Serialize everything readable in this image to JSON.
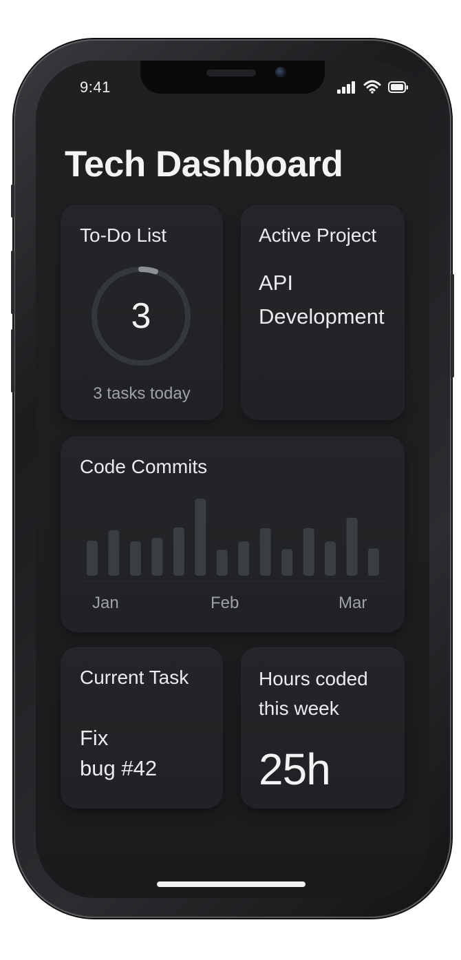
{
  "status_bar": {
    "time": "9:41",
    "icons": [
      "signal-icon",
      "wifi-icon",
      "battery-icon"
    ]
  },
  "title": "Tech Dashboard",
  "todo_card": {
    "label": "To-Do List",
    "count": "3",
    "subtitle": "3 tasks today",
    "progress_fraction": 0.05
  },
  "project_card": {
    "label": "Active Project",
    "name_line1": "API",
    "name_line2": "Development"
  },
  "commits_card": {
    "label": "Code Commits"
  },
  "task_card": {
    "label": "Current Task",
    "task_line1": "Fix",
    "task_line2": "bug #42"
  },
  "hours_card": {
    "label_line1": "Hours coded",
    "label_line2": "this week",
    "value": "25h"
  },
  "chart_data": {
    "type": "bar",
    "title": "Code Commits",
    "x_tick_labels": [
      "Jan",
      "Feb",
      "Mar"
    ],
    "values": [
      5,
      6.5,
      4.9,
      5.4,
      6.9,
      11,
      3.7,
      4.9,
      6.8,
      3.8,
      6.8,
      4.9,
      8.3,
      3.9
    ],
    "ylim": [
      0,
      12
    ],
    "bar_color": "#3a3d42",
    "grid": false,
    "legend": "none"
  },
  "colors": {
    "background": "#1c1e20",
    "card": "#222427",
    "text_primary": "#ececee",
    "text_secondary": "#9ea1a6",
    "ring_track": "#34373b",
    "ring_progress": "#8c9096"
  }
}
